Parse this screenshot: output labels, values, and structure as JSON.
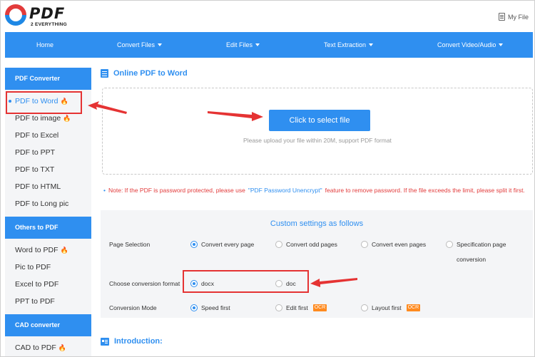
{
  "header": {
    "logo_text": "PDF",
    "logo_sub": "2 EVERYTHING",
    "my_file": "My File"
  },
  "nav": {
    "items": [
      {
        "label": "Home"
      },
      {
        "label": "Convert Files"
      },
      {
        "label": "Edit Files"
      },
      {
        "label": "Text Extraction"
      },
      {
        "label": "Convert Video/Audio"
      }
    ]
  },
  "sidebar": {
    "sections": [
      {
        "title": "PDF Converter",
        "items": [
          "PDF to Word",
          "PDF to image",
          "PDF to Excel",
          "PDF to PPT",
          "PDF to TXT",
          "PDF to HTML",
          "PDF to Long pic"
        ]
      },
      {
        "title": "Others to PDF",
        "items": [
          "Word to PDF",
          "Pic to PDF",
          "Excel to PDF",
          "PPT to PDF"
        ]
      },
      {
        "title": "CAD converter",
        "items": [
          "CAD to PDF"
        ]
      }
    ]
  },
  "main": {
    "title": "Online PDF to Word",
    "upload_button": "Click to select file",
    "upload_hint": "Please upload your file within 20M, support PDF format",
    "note_before": "Note: If the PDF is password protected, please use",
    "note_link": "\"PDF Password Unencrypt\"",
    "note_after": "feature to remove password. If the file exceeds the limit, please split it first.",
    "settings_title": "Custom settings as follows",
    "page_selection_label": "Page Selection",
    "page_options": [
      "Convert every page",
      "Convert odd pages",
      "Convert even pages",
      "Specification page conversion"
    ],
    "format_label": "Choose conversion format",
    "format_options": [
      "docx",
      "doc"
    ],
    "mode_label": "Conversion Mode",
    "mode_options": [
      "Speed first",
      "Edit first",
      "Layout first"
    ],
    "ocr_badge": "OCR",
    "intro_title": "Introduction:"
  },
  "icons": {
    "hot": "fire-icon",
    "accent": "#2f8ff0",
    "annotation": "#e53333"
  }
}
